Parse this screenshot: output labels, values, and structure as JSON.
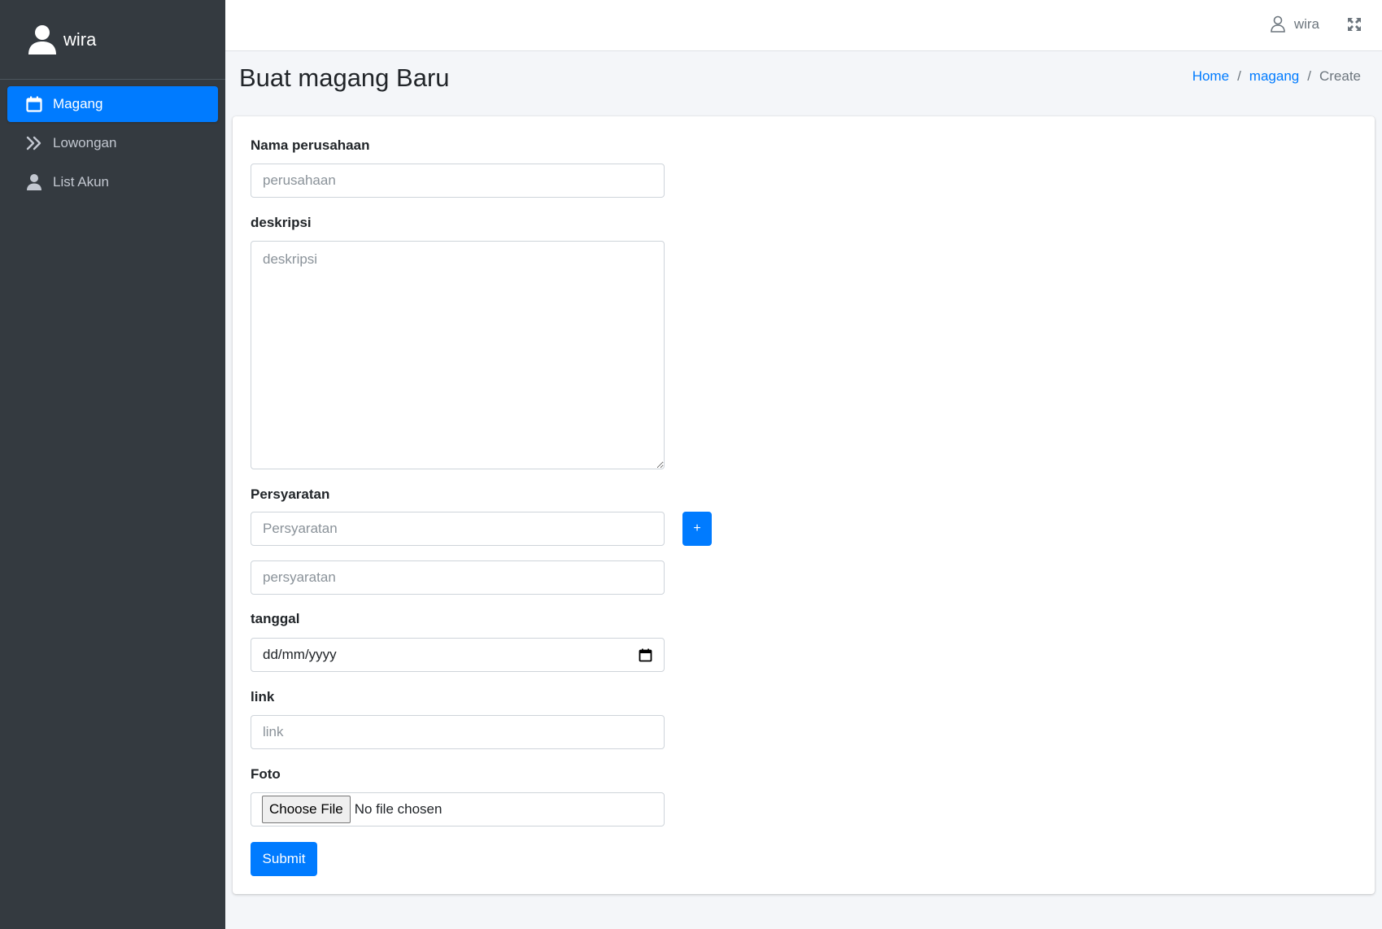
{
  "sidebar": {
    "user_name": "wira",
    "items": [
      {
        "label": "Magang",
        "icon": "calendar-icon",
        "active": true
      },
      {
        "label": "Lowongan",
        "icon": "angles-right-icon",
        "active": false
      },
      {
        "label": "List Akun",
        "icon": "user-icon",
        "active": false
      }
    ]
  },
  "navbar": {
    "user_name": "wira",
    "fullscreen_icon": "expand-icon"
  },
  "header": {
    "title": "Buat magang Baru",
    "breadcrumb": [
      "Home",
      "magang",
      "Create"
    ]
  },
  "form": {
    "company": {
      "label": "Nama perusahaan",
      "placeholder": "perusahaan"
    },
    "description": {
      "label": "deskripsi",
      "placeholder": "deskripsi"
    },
    "requirements": {
      "label": "Persyaratan",
      "placeholder_1": "Persyaratan",
      "placeholder_2": "persyaratan",
      "add_label": "+"
    },
    "date": {
      "label": "tanggal",
      "value": "dd/mm/yyyy"
    },
    "link": {
      "label": "link",
      "placeholder": "link"
    },
    "photo": {
      "label": "Foto",
      "button_label": "Choose File",
      "status": "No file chosen"
    },
    "submit_label": "Submit"
  },
  "colors": {
    "sidebar_bg": "#343a40",
    "primary": "#007bff",
    "content_bg": "#f4f6f9"
  }
}
